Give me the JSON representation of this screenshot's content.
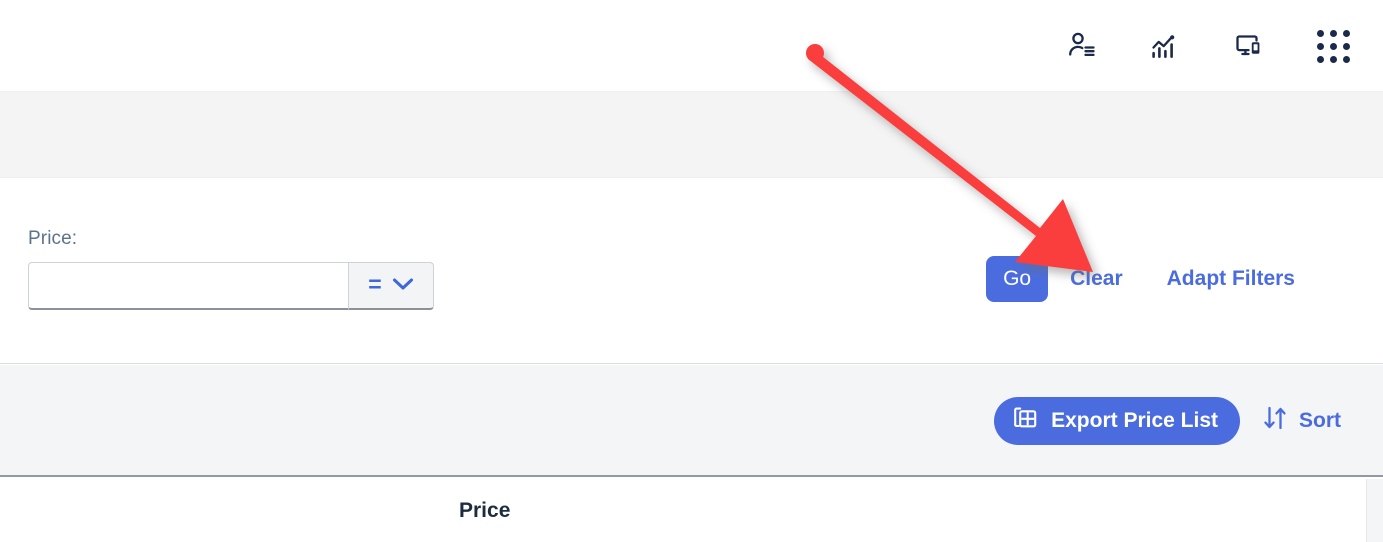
{
  "shell": {
    "icons": [
      {
        "name": "user-details-icon",
        "label": "User Details"
      },
      {
        "name": "analytics-chart-icon",
        "label": "Analytics"
      },
      {
        "name": "multi-device-icon",
        "label": "Devices"
      },
      {
        "name": "app-launcher-grid-icon",
        "label": "App Finder"
      }
    ]
  },
  "filter_bar": {
    "price_label": "Price:",
    "price_value": "",
    "price_placeholder": "",
    "operator_symbol": "=",
    "go_label": "Go",
    "clear_label": "Clear",
    "adapt_filters_label": "Adapt Filters"
  },
  "toolbar": {
    "export_label": "Export Price List",
    "sort_label": "Sort"
  },
  "table": {
    "columns": [
      {
        "label": "Price"
      }
    ]
  },
  "annotation": {
    "arrow_color": "#fa3e3e",
    "points_to": "Clear"
  },
  "colors": {
    "accent_blue": "#4a6cdf",
    "label_gray": "#5b738b",
    "band_gray": "#f4f4f4",
    "toolbar_gray": "#f4f5f7",
    "icon_navy": "#1b2a4a",
    "annotation_red": "#fa3e3e"
  }
}
